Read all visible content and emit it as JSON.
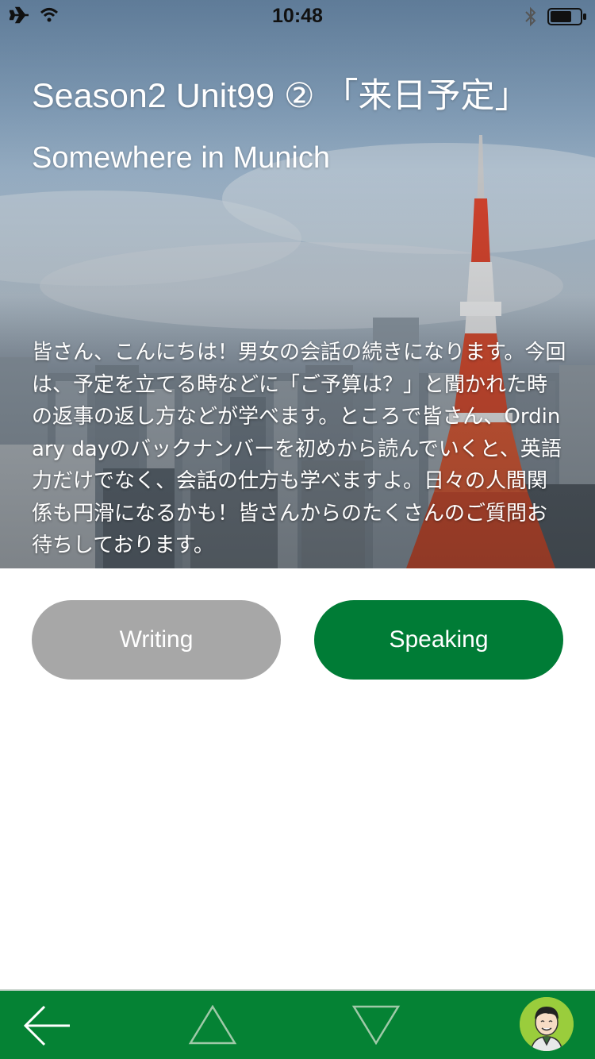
{
  "status_bar": {
    "time": "10:48",
    "icons": [
      "airplane-icon",
      "wifi-icon",
      "bluetooth-icon",
      "battery-icon"
    ]
  },
  "header": {
    "title": "Season2 Unit99 ② 「来日予定」",
    "subtitle": "Somewhere in Munich"
  },
  "description": "皆さん、こんにちは！男女の会話の続きになります。今回は、予定を立てる時などに「ご予算は？」と聞かれた時の返事の返し方などが学べます。ところで皆さん、Ordinary dayのバックナンバーを初めから読んでいくと、英語力だけでなく、会話の仕方も学べますよ。日々の人間関係も円滑になるかも！皆さんからのたくさんのご質問お待ちしております。",
  "buttons": {
    "writing_label": "Writing",
    "speaking_label": "Speaking"
  },
  "toolbar": {
    "icons": [
      "back-arrow-icon",
      "up-triangle-icon",
      "down-triangle-icon",
      "avatar-icon"
    ]
  },
  "colors": {
    "accent_green": "#007c36",
    "toolbar_green": "#058234",
    "disabled_gray": "#a7a7a7",
    "avatar_green": "#9acd3c"
  }
}
